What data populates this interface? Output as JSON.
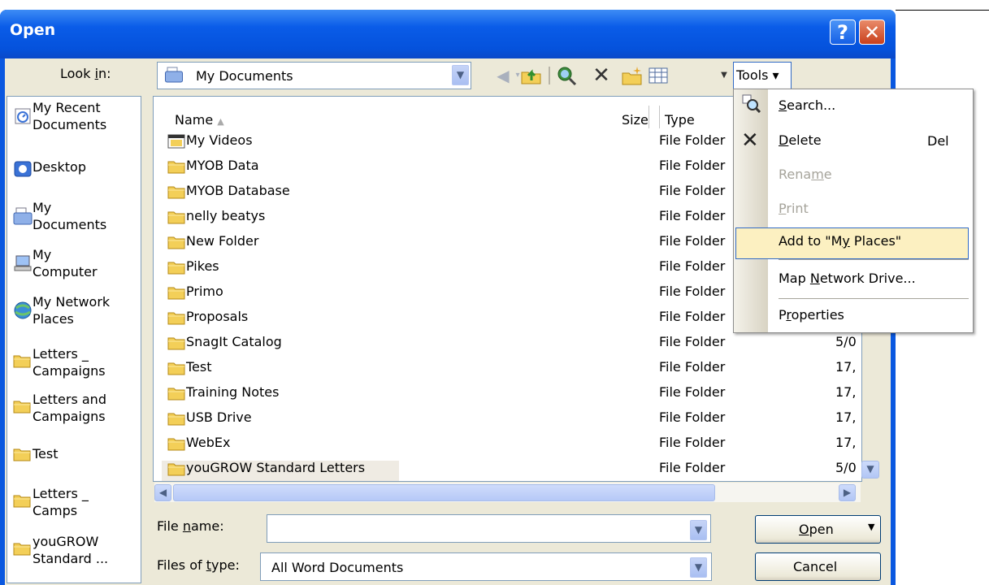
{
  "window": {
    "title": "Open"
  },
  "toolbar": {
    "look_in_label": "Look in:",
    "look_in_value": "My Documents",
    "tools_label": "Tools"
  },
  "places": [
    {
      "label_lines": [
        "My Recent",
        "Documents"
      ],
      "icon": "recent-documents-icon"
    },
    {
      "label_lines": [
        "Desktop"
      ],
      "icon": "desktop-icon"
    },
    {
      "label_lines": [
        "My",
        "Documents"
      ],
      "icon": "my-documents-icon"
    },
    {
      "label_lines": [
        "My",
        "Computer"
      ],
      "icon": "my-computer-icon"
    },
    {
      "label_lines": [
        "My Network",
        "Places"
      ],
      "icon": "network-places-icon"
    },
    {
      "label_lines": [
        "Letters _",
        "Campaigns"
      ],
      "icon": "folder-icon"
    },
    {
      "label_lines": [
        "Letters and",
        "Campaigns"
      ],
      "icon": "folder-icon"
    },
    {
      "label_lines": [
        "Test"
      ],
      "icon": "folder-icon"
    },
    {
      "label_lines": [
        "Letters _",
        "Camps"
      ],
      "icon": "folder-icon"
    },
    {
      "label_lines": [
        "youGROW",
        "Standard ..."
      ],
      "icon": "folder-icon"
    }
  ],
  "file_list": {
    "columns": {
      "name": "Name",
      "size": "Size",
      "type": "Type"
    },
    "rows": [
      {
        "name": "My Videos",
        "type": "File Folder",
        "date": ""
      },
      {
        "name": "MYOB Data",
        "type": "File Folder",
        "date": ""
      },
      {
        "name": "MYOB Database",
        "type": "File Folder",
        "date": ""
      },
      {
        "name": "nelly beatys",
        "type": "File Folder",
        "date": ""
      },
      {
        "name": "New Folder",
        "type": "File Folder",
        "date": ""
      },
      {
        "name": "Pikes",
        "type": "File Folder",
        "date": ""
      },
      {
        "name": "Primo",
        "type": "File Folder",
        "date": ""
      },
      {
        "name": "Proposals",
        "type": "File Folder",
        "date": ""
      },
      {
        "name": "SnagIt Catalog",
        "type": "File Folder",
        "date": "5/0"
      },
      {
        "name": "Test",
        "type": "File Folder",
        "date": "17,"
      },
      {
        "name": "Training Notes",
        "type": "File Folder",
        "date": "17,"
      },
      {
        "name": "USB Drive",
        "type": "File Folder",
        "date": "17,"
      },
      {
        "name": "WebEx",
        "type": "File Folder",
        "date": "17,"
      },
      {
        "name": "youGROW Standard Letters",
        "type": "File Folder",
        "date": "5/0"
      }
    ]
  },
  "bottom": {
    "file_name_label": "File name:",
    "file_name_value": "",
    "files_of_type_label": "Files of type:",
    "files_of_type_value": "All Word Documents",
    "open_label": "Open",
    "cancel_label": "Cancel"
  },
  "tools_menu": {
    "items": [
      {
        "label": "Search...",
        "shortcut": "",
        "enabled": true
      },
      {
        "label": "Delete",
        "shortcut": "Del",
        "enabled": true
      },
      {
        "label": "Rename",
        "shortcut": "",
        "enabled": false
      },
      {
        "label": "Print",
        "shortcut": "",
        "enabled": false
      },
      {
        "label": "Add to \"My Places\"",
        "shortcut": "",
        "enabled": true,
        "highlighted": true
      },
      {
        "label": "Map Network Drive...",
        "shortcut": "",
        "enabled": true
      },
      {
        "label": "Properties",
        "shortcut": "",
        "enabled": true
      }
    ]
  },
  "colors": {
    "title_bar": "#0a5ce8",
    "dialog_face": "#ece9d8",
    "menu_highlight": "#fcf0c1",
    "folder_yellow": "#f3cf58"
  }
}
